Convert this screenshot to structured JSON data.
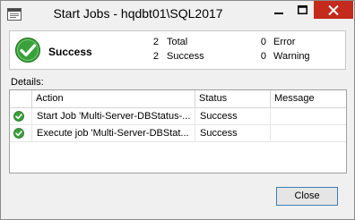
{
  "window": {
    "title": "Start Jobs - hqdbt01\\SQL2017"
  },
  "summary": {
    "status": "Success",
    "total_count": "2",
    "total_label": "Total",
    "success_count": "2",
    "success_label": "Success",
    "error_count": "0",
    "error_label": "Error",
    "warning_count": "0",
    "warning_label": "Warning"
  },
  "details": {
    "label": "Details:",
    "columns": [
      "Action",
      "Status",
      "Message"
    ],
    "rows": [
      {
        "icon": "success-icon",
        "action": "Start Job 'Multi-Server-DBStatus-...",
        "status": "Success",
        "message": ""
      },
      {
        "icon": "success-icon",
        "action": "Execute job 'Multi-Server-DBStat...",
        "status": "Success",
        "message": ""
      }
    ]
  },
  "buttons": {
    "close": "Close"
  },
  "colors": {
    "close_button_red": "#c42b1c",
    "success_green": "#3aa13a",
    "focus_border": "#3c7fb1"
  }
}
